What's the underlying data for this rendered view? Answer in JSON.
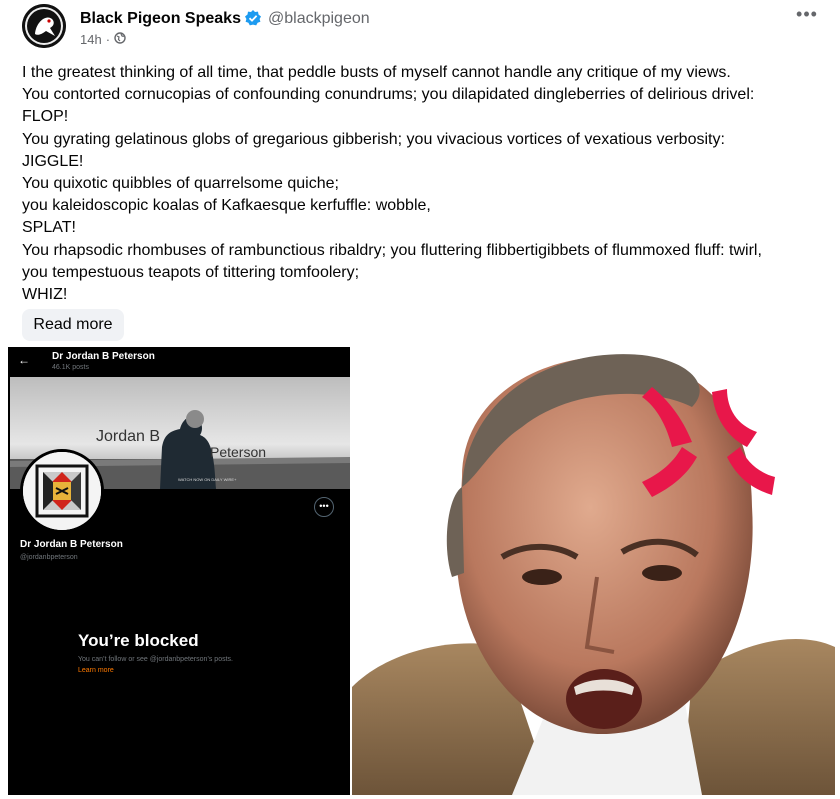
{
  "post": {
    "author_name": "Black Pigeon Speaks",
    "handle": "@blackpigeon",
    "time": "14h",
    "separator": "·",
    "more_icon": "ellipsis-icon",
    "body_lines": [
      "I the greatest thinking of all time, that peddle busts of myself cannot handle any critique of my views.",
      "You contorted cornucopias of confounding conundrums; you dilapidated dingleberries of delirious drivel:",
      "FLOP!",
      "You gyrating gelatinous globs of gregarious gibberish; you vivacious vortices of vexatious verbosity:",
      "JIGGLE!",
      "You quixotic quibbles of quarrelsome quiche;",
      "you kaleidoscopic koalas of Kafkaesque kerfuffle: wobble,",
      "SPLAT!",
      "You rhapsodic rhombuses of rambunctious ribaldry; you fluttering flibbertigibbets of flummoxed fluff: twirl,",
      "you tempestuous teapots of tittering tomfoolery;",
      "WHIZ!"
    ],
    "read_more_label": "Read more"
  },
  "screenshot": {
    "top_name": "Dr Jordan B Peterson",
    "posts_count": "46.1K posts",
    "banner_word_1": "Jordan B",
    "banner_word_2": "Peterson",
    "banner_tagline": "WATCH NOW ON DAILY WIRE+",
    "profile_name": "Dr Jordan B Peterson",
    "profile_handle": "@jordanbpeterson",
    "blocked_title": "You’re blocked",
    "blocked_desc": "You can’t follow or see @jordanbpeterson’s posts.",
    "learn_more": "Learn more"
  },
  "colors": {
    "verified_blue": "#1d9bf0",
    "secondary_text": "#65676b",
    "anger_red": "#e8174a"
  }
}
